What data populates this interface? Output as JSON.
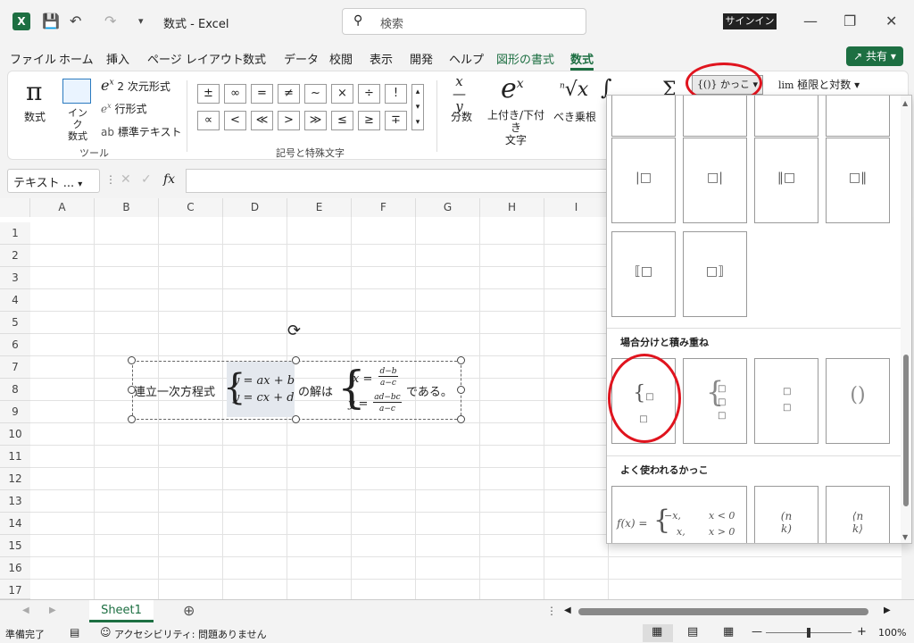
{
  "title": {
    "doc": "数式",
    "app": "Excel",
    "separator": "-",
    "search_placeholder": "検索",
    "signin": "サインイン"
  },
  "menu": {
    "tabs": [
      "ファイル",
      "ホーム",
      "挿入",
      "ページ レイアウト",
      "数式",
      "データ",
      "校閲",
      "表示",
      "開発",
      "ヘルプ",
      "図形の書式",
      "数式"
    ],
    "share": "共有"
  },
  "ribbon": {
    "tools": {
      "equation": "数式",
      "ink_eq": "インク\n数式",
      "linear_2d": "2 次元形式",
      "linear": "行形式",
      "normal_text": "標準テキスト",
      "group": "ツール"
    },
    "symbols": {
      "row1": [
        "±",
        "∞",
        "=",
        "≠",
        "~",
        "×",
        "÷",
        "!"
      ],
      "row2": [
        "∝",
        "<",
        "≪",
        ">",
        "≫",
        "≤",
        "≥",
        "∓"
      ],
      "group": "記号と特殊文字"
    },
    "structures": {
      "fraction": "分数",
      "script": "上付き/下付き\n文字",
      "radical": "べき乗根",
      "brackets": "かっこ",
      "limit": "極限と対数"
    }
  },
  "formula_bar": {
    "namebox": "テキスト ...",
    "fx": "fx"
  },
  "columns": [
    "A",
    "B",
    "C",
    "D",
    "E",
    "F",
    "G",
    "H",
    "I"
  ],
  "rows": [
    "1",
    "2",
    "3",
    "4",
    "5",
    "6",
    "7",
    "8",
    "9",
    "10",
    "11",
    "12",
    "13",
    "14",
    "15",
    "16",
    "17"
  ],
  "textbox": {
    "prefix": "連立一次方程式",
    "eq1": "y = ax + b",
    "eq2": "y = cx + d",
    "middle": "の解は",
    "x_lhs": "x =",
    "x_num": "d−b",
    "x_den": "a−c",
    "y_lhs": "y =",
    "y_num": "ad−bc",
    "y_den": "a−c",
    "suffix": "である。"
  },
  "panel": {
    "section_cases": "場合分けと積み重ね",
    "section_common": "よく使われるかっこ",
    "common_example_f": "f(x) =",
    "common_example_top": "−x,",
    "common_example_top_cond": "x < 0",
    "common_example_bottom": "x,",
    "common_example_bottom_cond": "x > 0"
  },
  "sheet": {
    "tab": "Sheet1"
  },
  "status": {
    "ready": "準備完了",
    "accessibility": "アクセシビリティ: 問題ありません",
    "zoom": "100%"
  }
}
